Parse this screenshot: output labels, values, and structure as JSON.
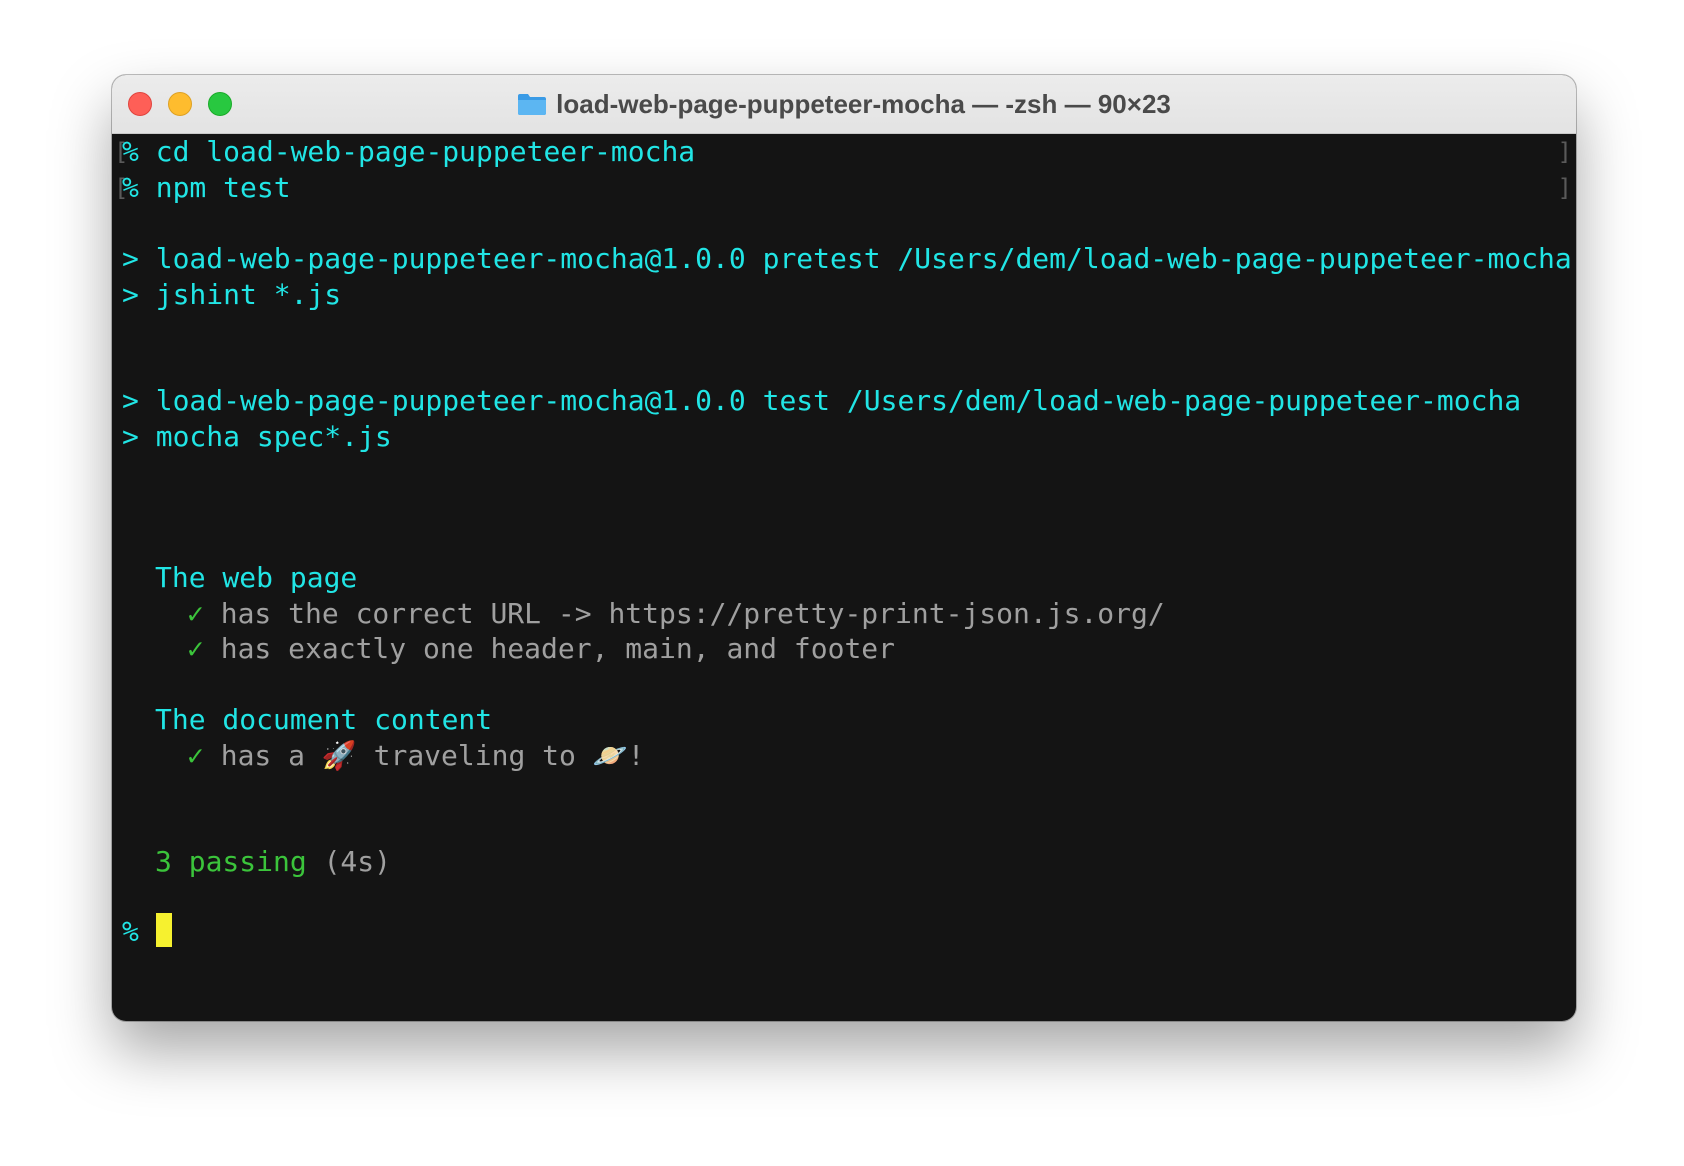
{
  "window": {
    "title": "load-web-page-puppeteer-mocha — -zsh — 90×23",
    "icon": "folder-icon"
  },
  "terminal": {
    "prompt_lines": [
      {
        "prompt": "%",
        "command": "cd load-web-page-puppeteer-mocha"
      },
      {
        "prompt": "%",
        "command": "npm test"
      }
    ],
    "script_lines": [
      "> load-web-page-puppeteer-mocha@1.0.0 pretest /Users/dem/load-web-page-puppeteer-mocha",
      "> jshint *.js",
      "> load-web-page-puppeteer-mocha@1.0.0 test /Users/dem/load-web-page-puppeteer-mocha",
      "> mocha spec*.js"
    ],
    "suites": [
      {
        "title": "The web page",
        "tests": [
          "has the correct URL -> https://pretty-print-json.js.org/",
          "has exactly one header, main, and footer"
        ]
      },
      {
        "title": "The document content",
        "tests_parts": {
          "before": "has a ",
          "rocket": "🚀",
          "middle": " traveling to ",
          "planet": "🪐",
          "after": "!"
        }
      }
    ],
    "check_mark": "✓",
    "summary_passing": "3 passing",
    "summary_time": "(4s)",
    "final_prompt": "%"
  },
  "colors": {
    "terminal_bg": "#141414",
    "cyan": "#21e5e5",
    "gray": "#a0a0a0",
    "green": "#3bc43b",
    "cursor": "#f6f12f"
  }
}
